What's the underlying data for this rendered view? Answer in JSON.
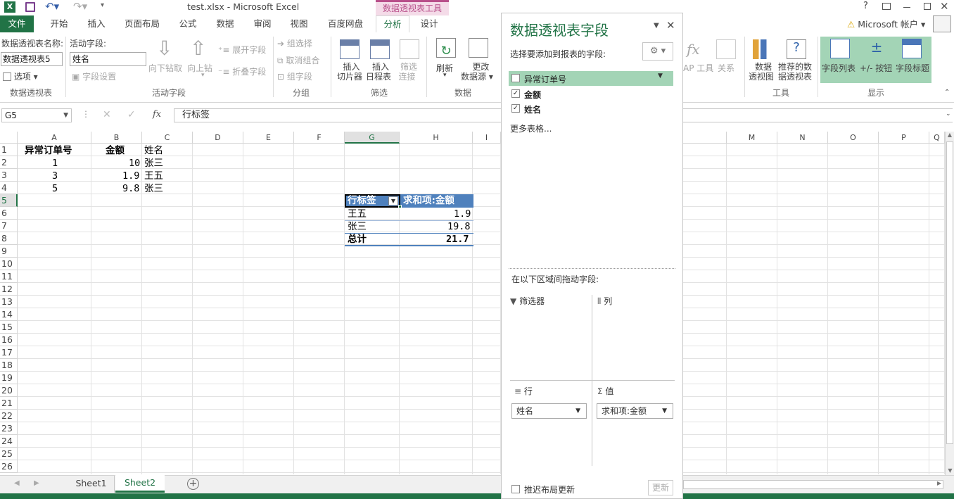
{
  "window": {
    "title": "test.xlsx - Microsoft Excel",
    "context_tool": "数据透视表工具",
    "account": "Microsoft 帐户",
    "help": "?"
  },
  "tabs": [
    {
      "label": "文件"
    },
    {
      "label": "开始"
    },
    {
      "label": "插入"
    },
    {
      "label": "页面布局"
    },
    {
      "label": "公式"
    },
    {
      "label": "数据"
    },
    {
      "label": "审阅"
    },
    {
      "label": "视图"
    },
    {
      "label": "百度网盘"
    },
    {
      "label": "分析"
    },
    {
      "label": "设计"
    }
  ],
  "ribbon": {
    "pt_name_label": "数据透视表名称:",
    "pt_name_value": "数据透视表5",
    "options": "选项",
    "active_field_label": "活动字段:",
    "active_field_value": "姓名",
    "field_settings": "字段设置",
    "drill_down": "向下钻取",
    "drill_up": "向上钻",
    "expand": "展开字段",
    "collapse": "折叠字段",
    "group_sel": "组选择",
    "ungroup": "取消组合",
    "group_field": "组字段",
    "slicer_1": "插入",
    "slicer_2": "切片器",
    "timeline_1": "插入",
    "timeline_2": "日程表",
    "filter_conn_1": "筛选",
    "filter_conn_2": "连接",
    "refresh": "刷新",
    "change_src_1": "更改",
    "change_src_2": "数据源",
    "olap": "AP 工具",
    "relations": "关系",
    "pivotchart_1": "数据",
    "pivotchart_2": "透视图",
    "recommended_1": "推荐的数",
    "recommended_2": "据透视表",
    "field_list": "字段列表",
    "pm_buttons": "+/- 按钮",
    "field_headers": "字段标题",
    "groups": {
      "pivot": "数据透视表",
      "active": "活动字段",
      "group": "分组",
      "filter": "筛选",
      "data": "数据",
      "tools": "工具",
      "show": "显示"
    }
  },
  "formula": {
    "namebox": "G5",
    "fx": "fx",
    "content": "行标签"
  },
  "columns": [
    "A",
    "B",
    "C",
    "D",
    "E",
    "F",
    "G",
    "H",
    "I",
    "M",
    "N",
    "O",
    "P",
    "Q"
  ],
  "rows": [
    "1",
    "2",
    "3",
    "4",
    "5",
    "6",
    "7",
    "8",
    "9",
    "10",
    "11",
    "12",
    "13",
    "14",
    "15",
    "16",
    "17",
    "18",
    "19",
    "20",
    "21",
    "22",
    "23",
    "24",
    "25",
    "26"
  ],
  "cells": {
    "a1": "异常订单号",
    "b1": "金额",
    "c1": "姓名",
    "a2": "1",
    "b2": "10",
    "c2": "张三",
    "a3": "3",
    "b3": "1.9",
    "c3": "王五",
    "a4": "5",
    "b4": "9.8",
    "c4": "张三"
  },
  "pivot": {
    "row_label": "行标签",
    "value_header": "求和项:金额",
    "rows": [
      {
        "name": "王五",
        "value": "1.9"
      },
      {
        "name": "张三",
        "value": "19.8"
      }
    ],
    "total_label": "总计",
    "total_value": "21.7"
  },
  "panel": {
    "title": "数据透视表字段",
    "choose_label": "选择要添加到报表的字段:",
    "fields": [
      {
        "name": "异常订单号",
        "checked": false
      },
      {
        "name": "金额",
        "checked": true
      },
      {
        "name": "姓名",
        "checked": true
      }
    ],
    "more_tables": "更多表格...",
    "drag_label": "在以下区域间拖动字段:",
    "filters": "筛选器",
    "columns": "列",
    "rows": "行",
    "values": "值",
    "row_item": "姓名",
    "value_item": "求和项:金额",
    "defer": "推迟布局更新",
    "update": "更新"
  },
  "sheets": [
    {
      "name": "Sheet1"
    },
    {
      "name": "Sheet2"
    }
  ],
  "colors": {
    "excel_green": "#217346",
    "pivot_blue": "#4f81bd",
    "context_pink": "#f4dbe8",
    "show_group": "#a3d4b6"
  }
}
